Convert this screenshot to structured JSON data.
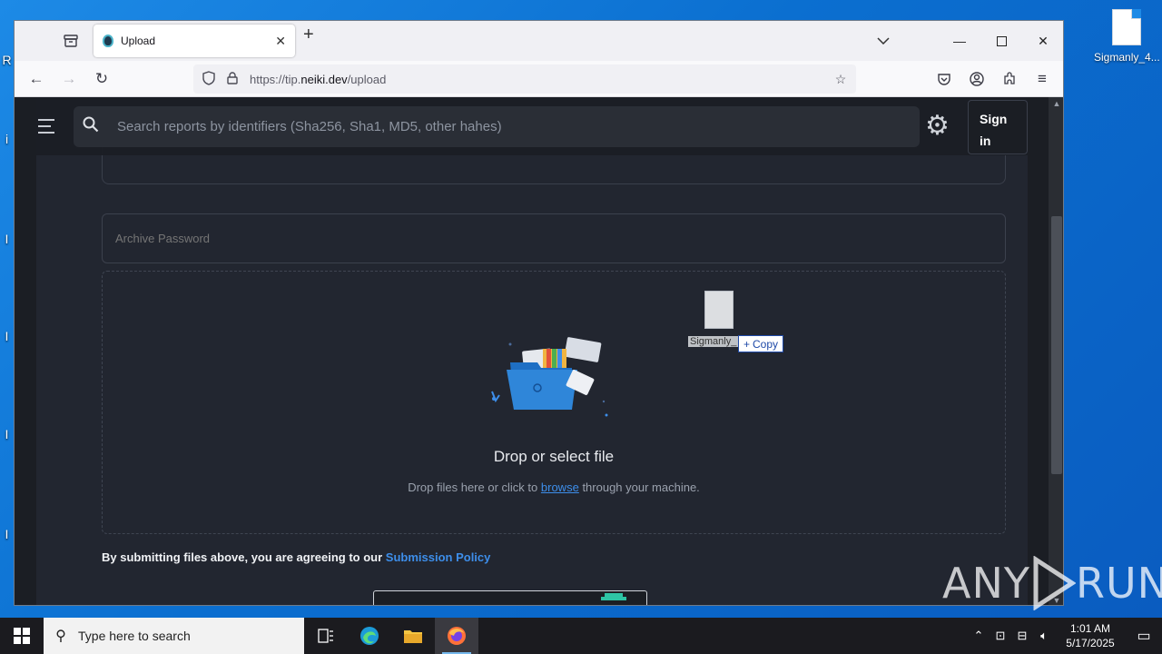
{
  "desktop": {
    "icons": [
      {
        "label": "Sigmanly_4..."
      }
    ]
  },
  "browser": {
    "tab": {
      "title": "Upload"
    },
    "url": {
      "prefix": "https://tip.",
      "domain": "neiki.dev",
      "path": "/upload"
    }
  },
  "site": {
    "search": {
      "placeholder": "Search reports by identifiers (Sha256, Sha1, MD5, other hahes)"
    },
    "signin_label": "Sign in",
    "archive_password": {
      "placeholder": "Archive Password"
    },
    "dropzone": {
      "title": "Drop or select file",
      "sub_before": "Drop files here or click to",
      "browse_link": "browse",
      "sub_after": "through your machine."
    },
    "consent": {
      "text": "By submitting files above, you are agreeing to our",
      "link": "Submission Policy"
    }
  },
  "drag": {
    "file_label": "Sigmanly_",
    "copy_label": "Copy"
  },
  "watermark": {
    "text_left": "ANY",
    "text_right": "RUN"
  },
  "taskbar": {
    "search_placeholder": "Type here to search",
    "time": "1:01 AM",
    "date": "5/17/2025"
  }
}
